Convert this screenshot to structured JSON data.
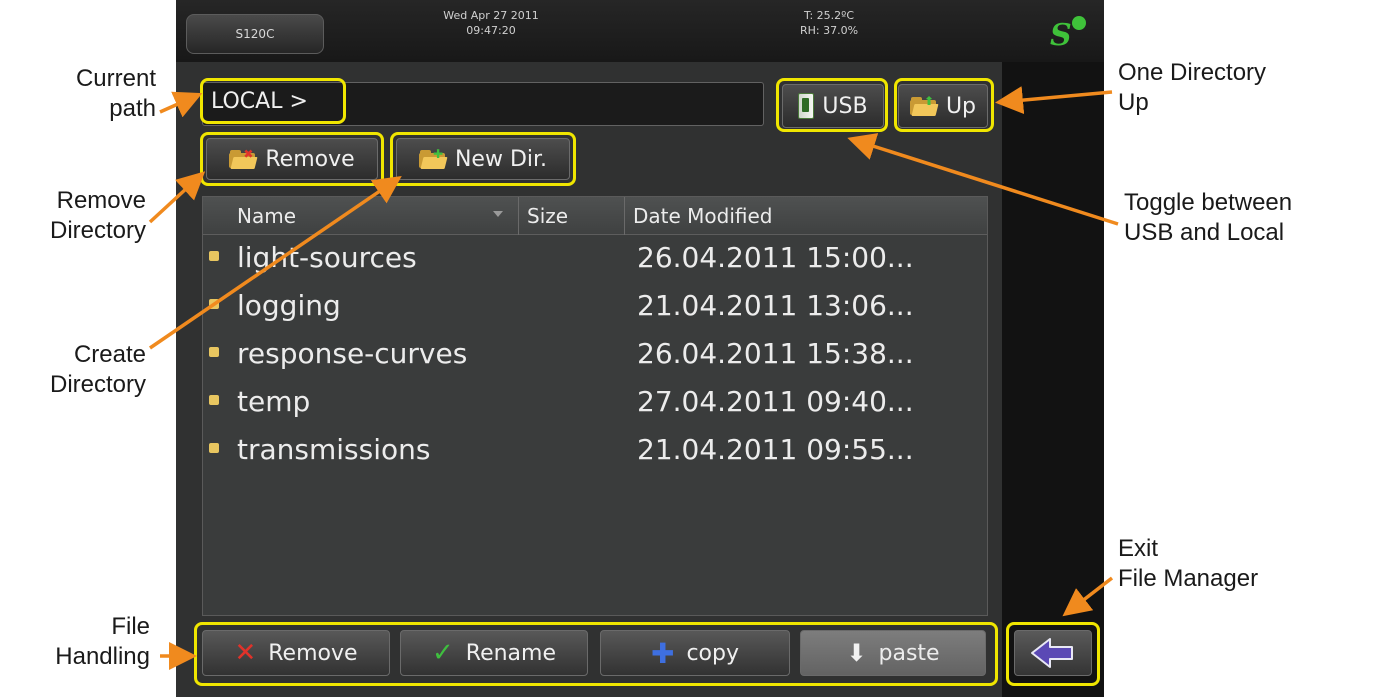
{
  "status_bar": {
    "device": "S120C",
    "date": "Wed Apr 27 2011",
    "time": "09:47:20",
    "temperature": "T: 25.2ºC",
    "humidity": "RH: 37.0%",
    "logo": "S"
  },
  "path": {
    "value": "LOCAL >"
  },
  "toolbar": {
    "usb_label": "USB",
    "up_label": "Up",
    "remove_dir_label": "Remove",
    "new_dir_label": "New Dir."
  },
  "file_list": {
    "columns": [
      "Name",
      "Size",
      "Date Modified"
    ],
    "rows": [
      {
        "name": "light-sources",
        "size": "",
        "date": "26.04.2011 15:00..."
      },
      {
        "name": "logging",
        "size": "",
        "date": "21.04.2011 13:06..."
      },
      {
        "name": "response-curves",
        "size": "",
        "date": "26.04.2011 15:38..."
      },
      {
        "name": "temp",
        "size": "",
        "date": "27.04.2011 09:40..."
      },
      {
        "name": "transmissions",
        "size": "",
        "date": "21.04.2011 09:55..."
      }
    ]
  },
  "file_actions": {
    "remove": "Remove",
    "rename": "Rename",
    "copy": "copy",
    "paste": "paste"
  },
  "annotations": {
    "current_path": [
      "Current",
      "path"
    ],
    "remove_directory": [
      "Remove",
      "Directory"
    ],
    "create_directory": [
      "Create",
      "Directory"
    ],
    "file_handling": [
      "File",
      "Handling"
    ],
    "one_directory_up": [
      "One Directory",
      "Up"
    ],
    "toggle_usb_local": [
      "Toggle between",
      "USB and Local"
    ],
    "exit_file_manager": [
      "Exit",
      "File Manager"
    ]
  },
  "colors": {
    "highlight": "#f0e600",
    "arrow": "#f08a1e",
    "remove_red": "#e0322a",
    "rename_green": "#3fbf3f",
    "copy_blue": "#3e6fe0",
    "exit_arrow": "#5b49b5"
  },
  "icons": [
    "folder-remove-icon",
    "folder-new-icon",
    "folder-up-icon",
    "usb-icon",
    "folder-icon",
    "sort-arrow-icon",
    "x-icon",
    "check-icon",
    "plus-icon",
    "down-arrow-icon",
    "back-arrow-icon"
  ]
}
